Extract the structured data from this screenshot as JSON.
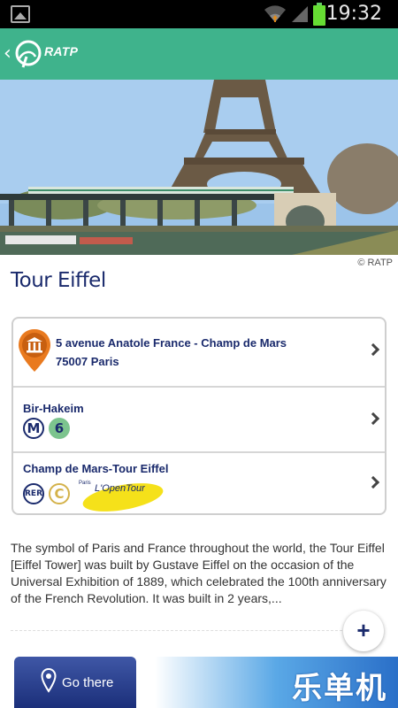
{
  "status_bar": {
    "time": "19:32"
  },
  "app_bar": {
    "brand": "RATP"
  },
  "photo": {
    "credit": "© RATP"
  },
  "place": {
    "title": "Tour Eiffel"
  },
  "address": {
    "line1": "5 avenue Anatole France - Champ de Mars",
    "line2": "75007 Paris"
  },
  "stops": [
    {
      "name": "Bir-Hakeim",
      "modes": [
        {
          "label": "M",
          "kind": "metro"
        },
        {
          "label": "6",
          "kind": "line"
        }
      ]
    },
    {
      "name": "Champ de Mars-Tour Eiffel",
      "modes": [
        {
          "label": "RER",
          "kind": "rer"
        },
        {
          "label": "C",
          "kind": "line"
        }
      ],
      "tour_logo": {
        "small": "Paris",
        "text": "L'OpenTour"
      }
    }
  ],
  "description": "The symbol of Paris and France throughout the world, the Tour Eiffel [Eiffel Tower] was built by Gustave Eiffel on the occasion of the Universal Exhibition of 1889, which celebrated the 100th anniversary of the French Revolution. It was built in 2 years,...",
  "actions": {
    "expand": "+",
    "go_there": "Go there"
  },
  "watermark": "乐单机",
  "colors": {
    "app_bar": "#3fb38c",
    "title": "#1a2a6c",
    "metro_6": "#7cc48e",
    "rer_c": "#d4b24a",
    "pin": "#e97a1f"
  }
}
